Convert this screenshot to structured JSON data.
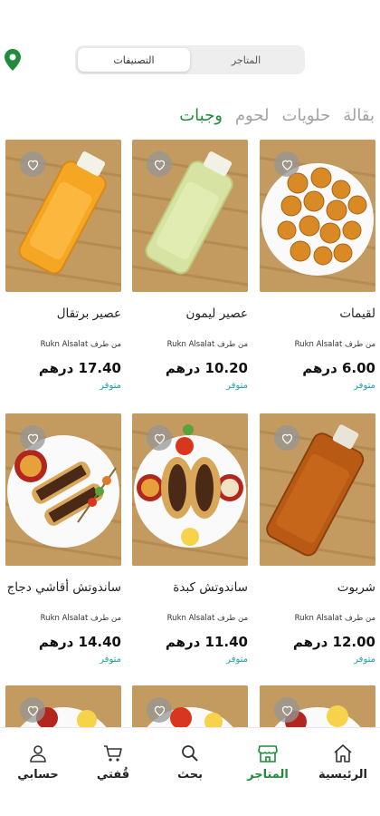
{
  "segment": {
    "stores_label": "المتاجر",
    "categories_label": "التصنيفات",
    "active": "categories"
  },
  "categories": [
    {
      "label": "بقالة",
      "active": false
    },
    {
      "label": "حلويات",
      "active": false
    },
    {
      "label": "لحوم",
      "active": false
    },
    {
      "label": "وجبات",
      "active": true
    }
  ],
  "products": [
    {
      "name": "لقيمات",
      "seller": "من طرف Rukn Alsalat",
      "price": "6.00 درهم",
      "stock": "متوفر",
      "image": "luqaimat-icon"
    },
    {
      "name": "عصير ليمون",
      "seller": "من طرف Rukn Alsalat",
      "price": "10.20 درهم",
      "stock": "متوفر",
      "image": "lemon-juice-icon"
    },
    {
      "name": "عصير برتقال",
      "seller": "من طرف Rukn Alsalat",
      "price": "17.40 درهم",
      "stock": "متوفر",
      "image": "orange-juice-icon"
    },
    {
      "name": "شربوت",
      "seller": "من طرف Rukn Alsalat",
      "price": "12.00 درهم",
      "stock": "متوفر",
      "image": "sharbat-icon"
    },
    {
      "name": "ساندوتش كبدة",
      "seller": "من طرف Rukn Alsalat",
      "price": "11.40 درهم",
      "stock": "متوفر",
      "image": "liver-sandwich-icon"
    },
    {
      "name": "ساندوتش أقاشي دجاج",
      "seller": "من طرف Rukn Alsalat",
      "price": "14.40 درهم",
      "stock": "متوفر",
      "image": "chicken-sandwich-icon"
    }
  ],
  "nav": [
    {
      "label": "الرئيسية",
      "icon": "home-icon",
      "active": false
    },
    {
      "label": "المتاجر",
      "icon": "store-icon",
      "active": true
    },
    {
      "label": "بحث",
      "icon": "search-icon",
      "active": false
    },
    {
      "label": "قُفتي",
      "icon": "cart-icon",
      "active": false
    },
    {
      "label": "حسابي",
      "icon": "user-icon",
      "active": false
    }
  ],
  "colors": {
    "accent": "#1f8b3b",
    "stock": "#20a3a3",
    "inactive_tab": "#a3a3a3"
  }
}
